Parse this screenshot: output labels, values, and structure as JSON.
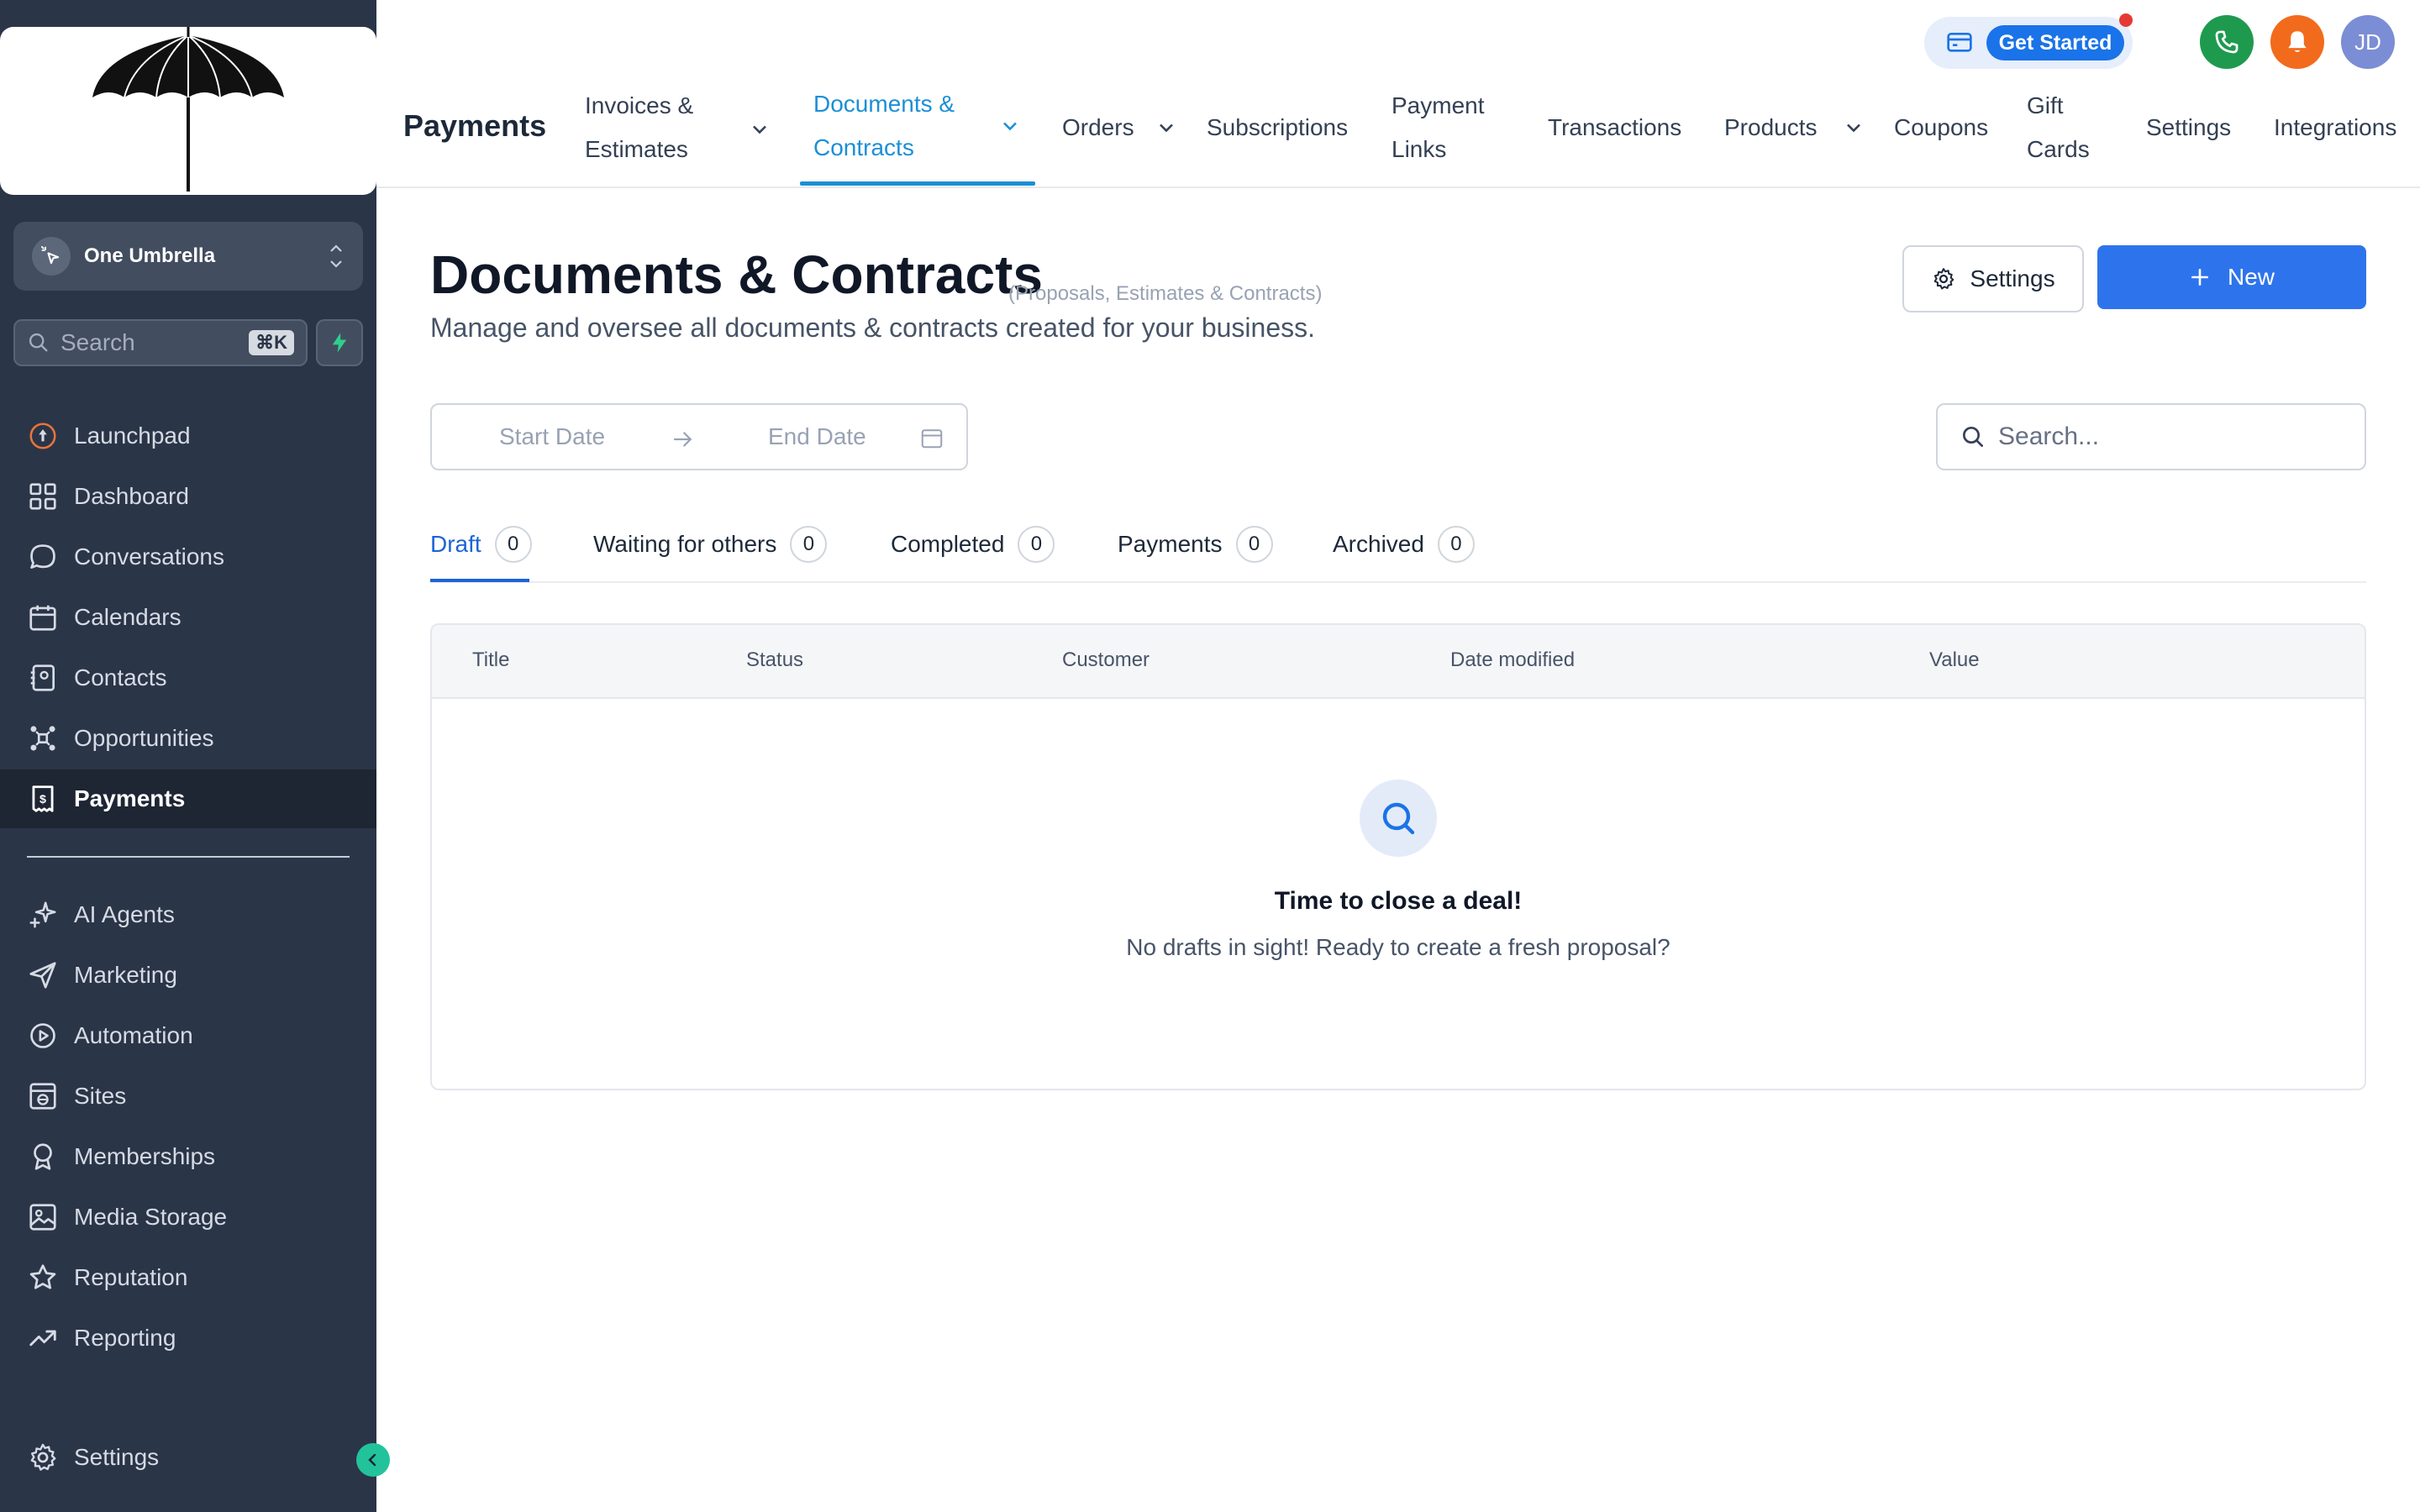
{
  "sidebar": {
    "location": {
      "name": "One Umbrella"
    },
    "search": {
      "placeholder": "Search",
      "shortcut": "⌘K"
    },
    "items": [
      {
        "label": "Launchpad",
        "icon": "launchpad-icon"
      },
      {
        "label": "Dashboard",
        "icon": "dashboard-icon"
      },
      {
        "label": "Conversations",
        "icon": "chat-icon"
      },
      {
        "label": "Calendars",
        "icon": "calendar-icon"
      },
      {
        "label": "Contacts",
        "icon": "contacts-icon"
      },
      {
        "label": "Opportunities",
        "icon": "opportunities-icon"
      },
      {
        "label": "Payments",
        "icon": "payments-icon",
        "active": true
      },
      {
        "label": "AI Agents",
        "icon": "sparkle-icon"
      },
      {
        "label": "Marketing",
        "icon": "send-icon"
      },
      {
        "label": "Automation",
        "icon": "automation-icon"
      },
      {
        "label": "Sites",
        "icon": "sites-icon"
      },
      {
        "label": "Memberships",
        "icon": "membership-icon"
      },
      {
        "label": "Media Storage",
        "icon": "image-icon"
      },
      {
        "label": "Reputation",
        "icon": "star-icon"
      },
      {
        "label": "Reporting",
        "icon": "trend-icon"
      }
    ],
    "settings_label": "Settings"
  },
  "topnav": {
    "section": "Payments",
    "items": [
      {
        "l1": "Invoices &",
        "l2": "Estimates",
        "dropdown": true
      },
      {
        "l1": "Documents &",
        "l2": "Contracts",
        "dropdown": true,
        "active": true
      },
      {
        "label": "Orders",
        "dropdown": true
      },
      {
        "label": "Subscriptions"
      },
      {
        "l1": "Payment",
        "l2": "Links"
      },
      {
        "label": "Transactions"
      },
      {
        "label": "Products",
        "dropdown": true
      },
      {
        "label": "Coupons"
      },
      {
        "l1": "Gift",
        "l2": "Cards"
      },
      {
        "label": "Settings"
      },
      {
        "label": "Integrations"
      }
    ],
    "get_started": "Get Started",
    "avatar_initials": "JD"
  },
  "page": {
    "title": "Documents & Contracts",
    "subtitle": "(Proposals, Estimates & Contracts)",
    "description": "Manage and oversee all documents & contracts created for your business.",
    "settings_button": "Settings",
    "new_button": "New",
    "start_date_placeholder": "Start Date",
    "end_date_placeholder": "End Date",
    "search_placeholder": "Search..."
  },
  "tabs": [
    {
      "label": "Draft",
      "count": "0",
      "active": true
    },
    {
      "label": "Waiting for others",
      "count": "0"
    },
    {
      "label": "Completed",
      "count": "0"
    },
    {
      "label": "Payments",
      "count": "0"
    },
    {
      "label": "Archived",
      "count": "0"
    }
  ],
  "table": {
    "columns": [
      "Title",
      "Status",
      "Customer",
      "Date modified",
      "Value"
    ],
    "empty_title": "Time to close a deal!",
    "empty_subtitle": "No drafts in sight! Ready to create a fresh proposal?"
  },
  "colors": {
    "sidebar_bg": "#2b3548",
    "accent": "#2d74ec",
    "active_tab": "#1c8fd6",
    "phone": "#1e9a4f",
    "notification": "#f26b1d",
    "avatar": "#7b8dd4"
  }
}
